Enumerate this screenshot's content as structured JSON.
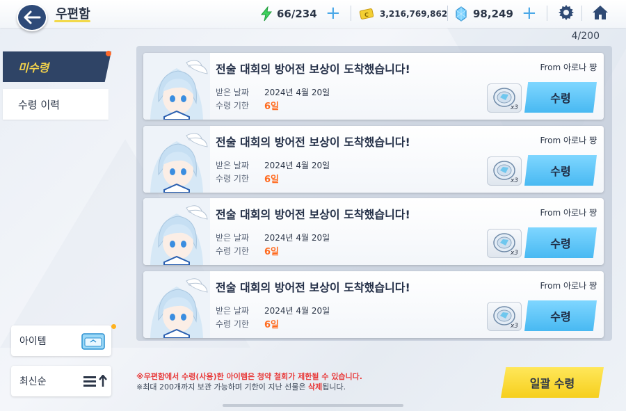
{
  "header": {
    "title": "우편함",
    "ap": "66/234",
    "credits": "3,216,769,862",
    "pyroxene": "98,249",
    "icons": [
      "back-arrow-icon",
      "lightning-icon",
      "plus-icon",
      "credit-icon",
      "pyroxene-icon",
      "gear-icon",
      "home-icon"
    ]
  },
  "counter": "4/200",
  "sidebar": {
    "tabs": [
      {
        "label": "미수령",
        "active": true,
        "badge": true
      },
      {
        "label": "수령 이력",
        "active": false
      }
    ],
    "item_filter_label": "아이템",
    "sort_label": "최신순"
  },
  "mail": {
    "items": [
      {
        "title": "전술 대회의 방어전 보상이 도착했습니다!",
        "from": "From 아로나 쨩",
        "received_label": "받은 날짜",
        "received_value": "2024년 4월 20일",
        "deadline_label": "수령 기한",
        "deadline_value": "6일",
        "reward_qty": "x3",
        "claim_label": "수령"
      },
      {
        "title": "전술 대회의 방어전 보상이 도착했습니다!",
        "from": "From 아로나 쨩",
        "received_label": "받은 날짜",
        "received_value": "2024년 4월 20일",
        "deadline_label": "수령 기한",
        "deadline_value": "6일",
        "reward_qty": "x3",
        "claim_label": "수령"
      },
      {
        "title": "전술 대회의 방어전 보상이 도착했습니다!",
        "from": "From 아로나 쨩",
        "received_label": "받은 날짜",
        "received_value": "2024년 4월 20일",
        "deadline_label": "수령 기한",
        "deadline_value": "6일",
        "reward_qty": "x3",
        "claim_label": "수령"
      },
      {
        "title": "전술 대회의 방어전 보상이 도착했습니다!",
        "from": "From 아로나 쨩",
        "received_label": "받은 날짜",
        "received_value": "2024년 4월 20일",
        "deadline_label": "수령 기한",
        "deadline_value": "6일",
        "reward_qty": "x3",
        "claim_label": "수령"
      }
    ]
  },
  "notices": {
    "line1": "※우편함에서 수령(사용)한 아이템은 청약 철회가 제한될 수 있습니다.",
    "line2_prefix": "※최대 200개까지 보관 가능하며 기한이 지난 선물은 ",
    "line2_highlight": "삭제",
    "line2_suffix": "됩니다."
  },
  "claim_all_label": "일괄 수령",
  "colors": {
    "accent_blue": "#48b9f2",
    "accent_yellow": "#f6cf1d",
    "deadline_orange": "#ff6a1e",
    "warning_red": "#e83a3a",
    "navy": "#2f4466"
  }
}
